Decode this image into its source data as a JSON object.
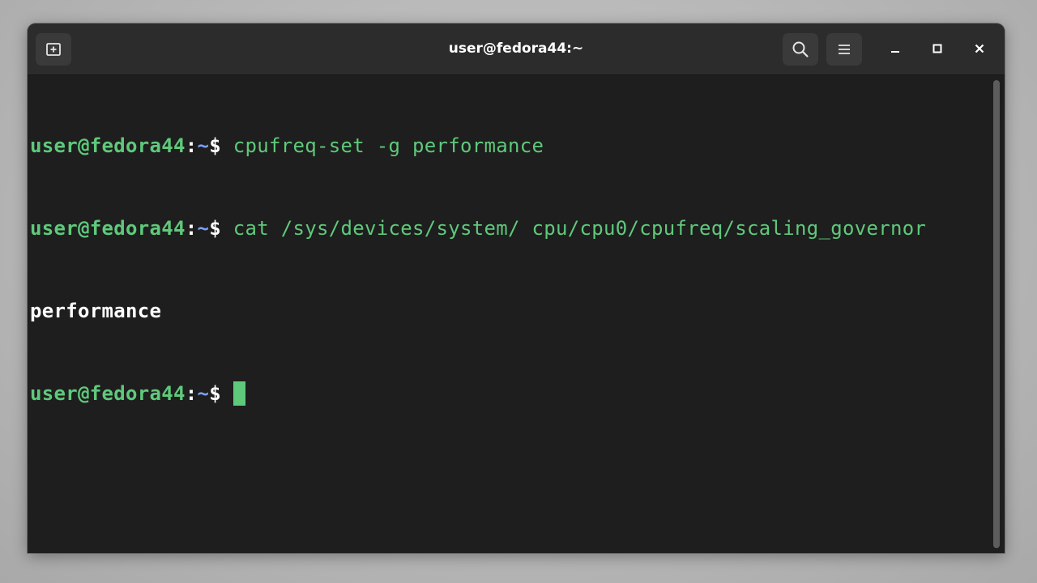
{
  "window": {
    "title": "user@fedora44:~"
  },
  "header": {
    "new_tab_icon": "new-tab-icon",
    "search_icon": "search-icon",
    "menu_icon": "hamburger-menu-icon",
    "minimize_icon": "minimize-icon",
    "maximize_icon": "maximize-icon",
    "close_icon": "close-icon"
  },
  "terminal": {
    "prompt_user_host": "user@fedora44",
    "prompt_colon": ":",
    "prompt_path": "~",
    "prompt_dollar": "$",
    "lines": [
      {
        "type": "command",
        "text": " cpufreq-set -g performance"
      },
      {
        "type": "command",
        "text": " cat /sys/devices/system/ cpu/cpu0/cpufreq/scaling_governor"
      },
      {
        "type": "output",
        "text": "performance"
      },
      {
        "type": "prompt",
        "text": " "
      }
    ]
  },
  "colors": {
    "prompt_green": "#5fc97b",
    "path_blue": "#7aa0ff",
    "output_white": "#ffffff",
    "terminal_bg": "#1e1e1e",
    "headerbar_bg": "#2c2c2c"
  }
}
